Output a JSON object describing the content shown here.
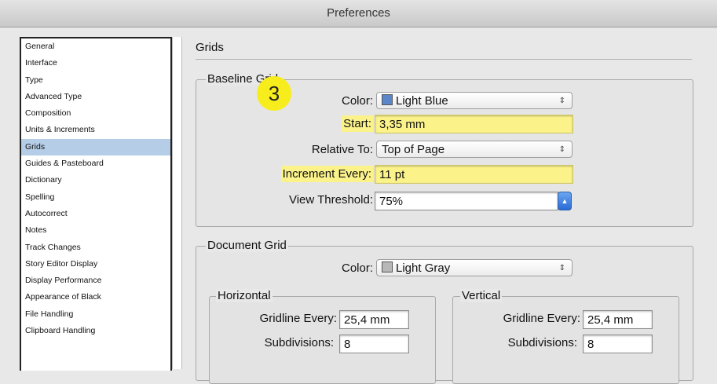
{
  "window": {
    "title": "Preferences"
  },
  "sidebar": {
    "items": [
      {
        "label": "General"
      },
      {
        "label": "Interface"
      },
      {
        "label": "Type"
      },
      {
        "label": "Advanced Type"
      },
      {
        "label": "Composition"
      },
      {
        "label": "Units & Increments"
      },
      {
        "label": "Grids",
        "selected": true
      },
      {
        "label": "Guides & Pasteboard"
      },
      {
        "label": "Dictionary"
      },
      {
        "label": "Spelling"
      },
      {
        "label": "Autocorrect"
      },
      {
        "label": "Notes"
      },
      {
        "label": "Track Changes"
      },
      {
        "label": "Story Editor Display"
      },
      {
        "label": "Display Performance"
      },
      {
        "label": "Appearance of Black"
      },
      {
        "label": "File Handling"
      },
      {
        "label": "Clipboard Handling"
      }
    ]
  },
  "main": {
    "title": "Grids",
    "baseline_grid": {
      "legend": "Baseline Grid",
      "color_label": "Color:",
      "color_value": "Light Blue",
      "color_swatch": "#5b86c8",
      "start_label": "Start:",
      "start_value": "3,35 mm",
      "relative_label": "Relative To:",
      "relative_value": "Top of Page",
      "increment_label": "Increment Every:",
      "increment_value": "11 pt",
      "threshold_label": "View Threshold:",
      "threshold_value": "75%"
    },
    "document_grid": {
      "legend": "Document Grid",
      "color_label": "Color:",
      "color_value": "Light Gray",
      "color_swatch": "#b8b8b8",
      "horizontal": {
        "legend": "Horizontal",
        "gridline_label": "Gridline Every:",
        "gridline_value": "25,4 mm",
        "subdivisions_label": "Subdivisions:",
        "subdivisions_value": "8"
      },
      "vertical": {
        "legend": "Vertical",
        "gridline_label": "Gridline Every:",
        "gridline_value": "25,4 mm",
        "subdivisions_label": "Subdivisions:",
        "subdivisions_value": "8"
      }
    }
  },
  "annotation": {
    "step_number": "3"
  },
  "colors": {
    "highlight": "#fbf38a",
    "selection": "#b5cde6",
    "badge": "#f8ed1c"
  }
}
